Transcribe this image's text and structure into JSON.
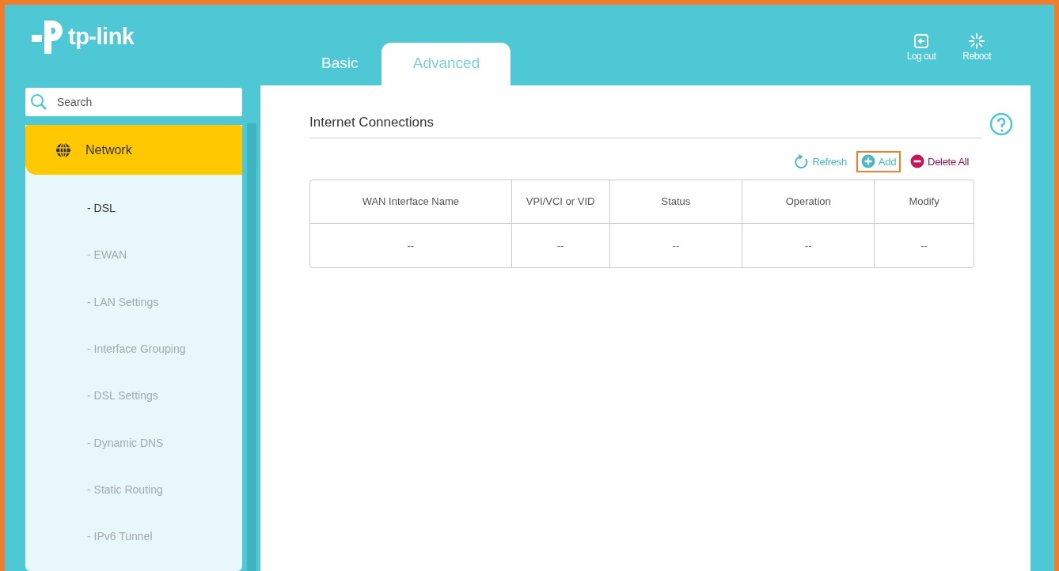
{
  "header": {
    "logo_text": "tp-link",
    "tabs": [
      {
        "label": "Basic",
        "selected": false
      },
      {
        "label": "Advanced",
        "selected": true
      }
    ],
    "buttons": [
      {
        "kind": "logout",
        "label": "Log out"
      },
      {
        "kind": "reboot",
        "label": "Reboot"
      }
    ]
  },
  "sidebar": {
    "search": {
      "placeholder": "Search"
    },
    "groups": [
      {
        "label": "Network",
        "selected": true,
        "children": [
          {
            "label": "- DSL",
            "selected": true
          },
          {
            "label": "- EWAN",
            "selected": false
          },
          {
            "label": "- LAN Settings",
            "selected": false
          },
          {
            "label": "- Interface Grouping",
            "selected": false
          },
          {
            "label": "- DSL Settings",
            "selected": false
          },
          {
            "label": "- Dynamic DNS",
            "selected": false
          },
          {
            "label": "- Static Routing",
            "selected": false
          },
          {
            "label": "- IPv6 Tunnel",
            "selected": false
          }
        ]
      }
    ]
  },
  "panel": {
    "title": "Internet Connections",
    "actions": [
      {
        "kind": "refresh",
        "label": "Refresh",
        "highlighted": false
      },
      {
        "kind": "add",
        "label": "Add",
        "highlighted": true
      },
      {
        "kind": "delete",
        "label": "Delete All",
        "highlighted": false
      }
    ],
    "table": {
      "columns": [
        "WAN Interface Name",
        "VPI/VCI or VID",
        "Status",
        "Operation",
        "Modify"
      ],
      "rows": [
        [
          "--",
          "--",
          "--",
          "--",
          "--"
        ]
      ]
    }
  }
}
